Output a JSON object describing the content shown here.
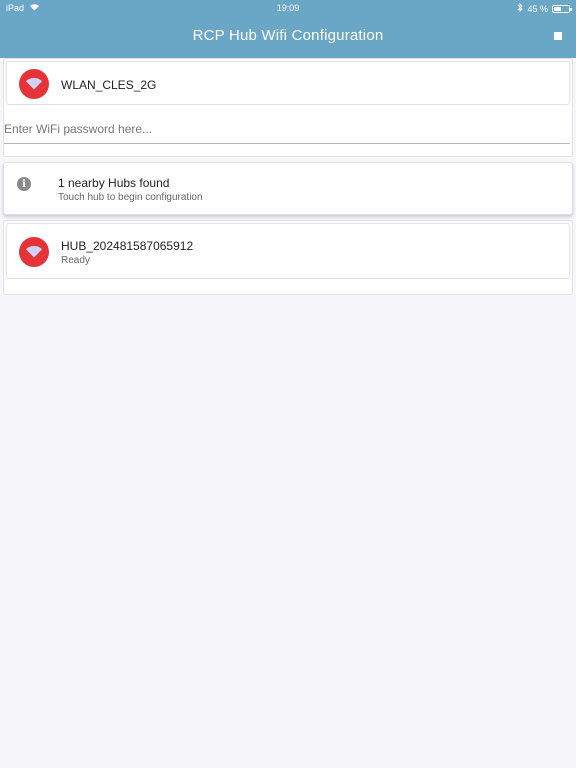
{
  "status_bar": {
    "device": "iPad",
    "time": "19:09",
    "battery": "45 %",
    "battery_level_percent": 45
  },
  "header": {
    "title": "RCP Hub Wifi Configuration"
  },
  "wifi_network": {
    "ssid": "WLAN_CLES_2G",
    "icon": "wifi-icon"
  },
  "password_field": {
    "placeholder": "Enter WiFi password here...",
    "value": ""
  },
  "scan_info": {
    "title": "1 nearby Hubs found",
    "subtitle": "Touch hub to begin configuration",
    "icon": "info-icon"
  },
  "hubs": [
    {
      "name": "HUB_202481587065912",
      "status": "Ready",
      "icon": "wifi-icon"
    }
  ],
  "colors": {
    "header": "#6aa6c6",
    "accent_red": "#e53338"
  }
}
